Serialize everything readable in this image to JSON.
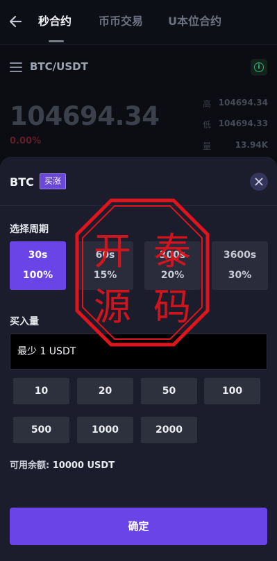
{
  "header": {
    "tabs": [
      {
        "label": "秒合约",
        "active": true
      },
      {
        "label": "币币交易",
        "active": false
      },
      {
        "label": "U本位合约",
        "active": false
      }
    ]
  },
  "market": {
    "pair": "BTC/USDT",
    "price": "104694.34",
    "change": "0.00%",
    "stats": [
      {
        "label": "高",
        "value": "104694.34"
      },
      {
        "label": "低",
        "value": "104694.33"
      },
      {
        "label": "量",
        "value": "13.94K"
      }
    ]
  },
  "order_sheet": {
    "coin": "BTC",
    "direction_badge": "买涨",
    "period_label": "选择周期",
    "periods": [
      {
        "time": "30s",
        "percent": "100%",
        "selected": true
      },
      {
        "time": "60s",
        "percent": "15%",
        "selected": false
      },
      {
        "time": "300s",
        "percent": "20%",
        "selected": false
      },
      {
        "time": "3600s",
        "percent": "30%",
        "selected": false
      }
    ],
    "amount_label": "买入量",
    "amount_placeholder": "最少 1 USDT",
    "quick_amounts": [
      "10",
      "20",
      "50",
      "100",
      "500",
      "1000",
      "2000"
    ],
    "balance_label": "可用余额:",
    "balance_value": "10000 USDT",
    "confirm_label": "确定"
  },
  "watermark": {
    "text": "开泰源码",
    "color": "#e0141c"
  },
  "colors": {
    "accent": "#6a44e6",
    "sheet_bg": "#1b1d2c",
    "page_bg": "#0b0d13"
  }
}
